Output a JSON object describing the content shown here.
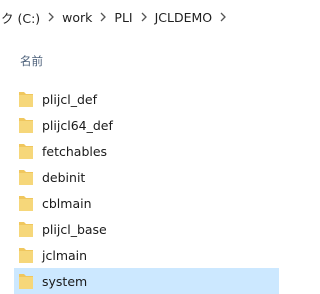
{
  "breadcrumb": {
    "drive_label": "ク (C:)",
    "items": [
      "work",
      "PLI",
      "JCLDEMO"
    ]
  },
  "columns": {
    "name_header": "名前"
  },
  "files": [
    {
      "name": "plijcl_def",
      "icon": "folder-icon"
    },
    {
      "name": "plijcl64_def",
      "icon": "folder-icon"
    },
    {
      "name": "fetchables",
      "icon": "folder-icon"
    },
    {
      "name": "debinit",
      "icon": "folder-icon"
    },
    {
      "name": "cblmain",
      "icon": "folder-icon"
    },
    {
      "name": "plijcl_base",
      "icon": "folder-icon"
    },
    {
      "name": "jclmain",
      "icon": "folder-icon"
    },
    {
      "name": "system",
      "icon": "folder-icon",
      "selected": true
    }
  ],
  "colors": {
    "selection": "#cce8ff",
    "folder": "#f0c75e",
    "header_text": "#4c607a"
  }
}
